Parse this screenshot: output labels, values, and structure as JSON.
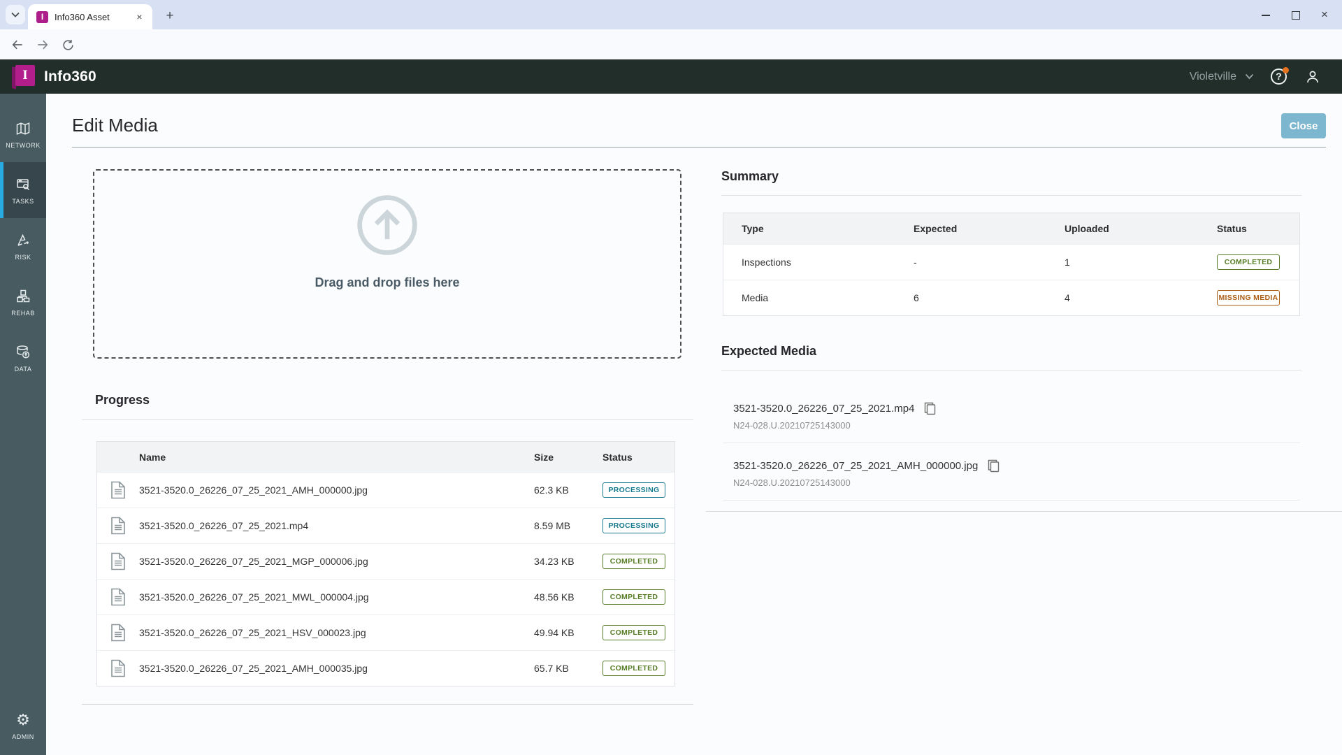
{
  "browser": {
    "tab_title": "Info360 Asset",
    "favicon_letter": "I",
    "url": "asset.info360.com/inspections/upload/PACP"
  },
  "header": {
    "brand": "Info360",
    "logo_letter": "I",
    "site_selector": "Violetville"
  },
  "sidebar": {
    "items": [
      {
        "label": "NETWORK"
      },
      {
        "label": "TASKS",
        "active": true
      },
      {
        "label": "RISK"
      },
      {
        "label": "REHAB"
      },
      {
        "label": "DATA"
      }
    ],
    "bottom_item": {
      "label": "ADMIN"
    }
  },
  "page": {
    "title": "Edit Media",
    "close_label": "Close",
    "dropzone_text": "Drag and drop files here",
    "progress": {
      "title": "Progress",
      "columns": [
        "Name",
        "Size",
        "Status"
      ],
      "rows": [
        {
          "name": "3521-3520.0_26226_07_25_2021_AMH_000000.jpg",
          "size": "62.3 KB",
          "status": "PROCESSING"
        },
        {
          "name": "3521-3520.0_26226_07_25_2021.mp4",
          "size": "8.59 MB",
          "status": "PROCESSING"
        },
        {
          "name": "3521-3520.0_26226_07_25_2021_MGP_000006.jpg",
          "size": "34.23 KB",
          "status": "COMPLETED"
        },
        {
          "name": "3521-3520.0_26226_07_25_2021_MWL_000004.jpg",
          "size": "48.56 KB",
          "status": "COMPLETED"
        },
        {
          "name": "3521-3520.0_26226_07_25_2021_HSV_000023.jpg",
          "size": "49.94 KB",
          "status": "COMPLETED"
        },
        {
          "name": "3521-3520.0_26226_07_25_2021_AMH_000035.jpg",
          "size": "65.7 KB",
          "status": "COMPLETED"
        }
      ]
    },
    "summary": {
      "title": "Summary",
      "columns": [
        "Type",
        "Expected",
        "Uploaded",
        "Status"
      ],
      "rows": [
        {
          "type": "Inspections",
          "expected": "-",
          "uploaded": "1",
          "status": "COMPLETED"
        },
        {
          "type": "Media",
          "expected": "6",
          "uploaded": "4",
          "status": "MISSING MEDIA"
        }
      ]
    },
    "expected_media": {
      "title": "Expected Media",
      "items": [
        {
          "name": "3521-3520.0_26226_07_25_2021.mp4",
          "code": "N24-028.U.20210725143000"
        },
        {
          "name": "3521-3520.0_26226_07_25_2021_AMH_000000.jpg",
          "code": "N24-028.U.20210725143000"
        }
      ]
    }
  },
  "colors": {
    "accent_cyan": "#29abe2",
    "brand_magenta": "#b21f8d",
    "close_button_blue": "#7db7cf",
    "badge_processing": "#17798e",
    "badge_completed": "#567c26",
    "badge_missing_media": "#ab5d16",
    "appbar_dark": "#212e2a",
    "sidebar_slate": "#475b61"
  }
}
